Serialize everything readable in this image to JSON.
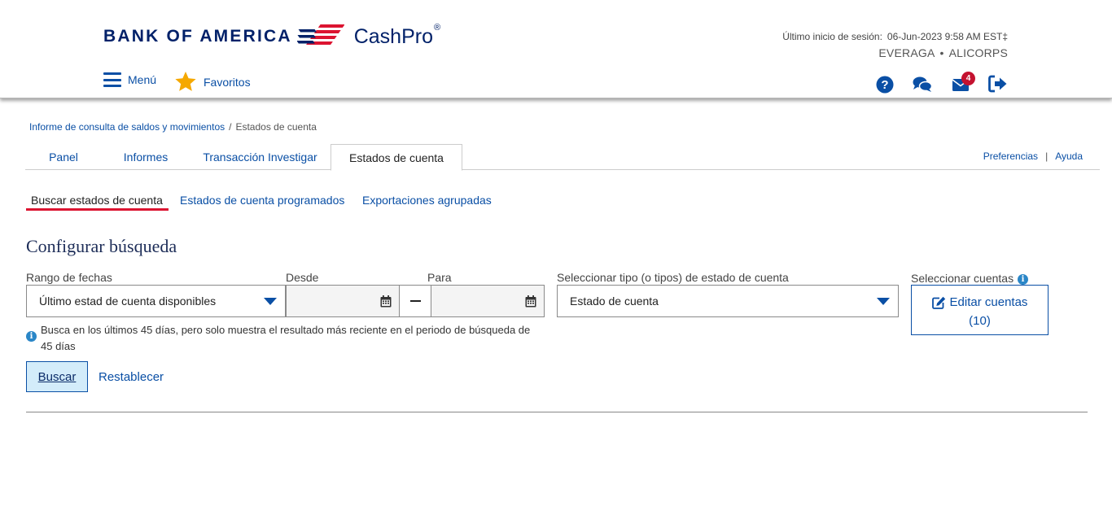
{
  "brand": {
    "bank_name": "BANK OF AMERICA",
    "product": "CashPro",
    "product_mark": "®"
  },
  "session": {
    "last_login_label": "Último inicio de sesión:",
    "last_login_value": "06-Jun-2023 9:58 AM EST‡",
    "user": "EVERAGA",
    "separator": "•",
    "company": "ALICORPS"
  },
  "nav": {
    "menu_label": "Menú",
    "favorites_label": "Favoritos",
    "messages_count": "4"
  },
  "breadcrumb": {
    "parent": "Informe de consulta de saldos y movimientos",
    "separator": "/",
    "current": "Estados de cuenta"
  },
  "tabs": [
    {
      "label": "Panel"
    },
    {
      "label": "Informes"
    },
    {
      "label": "Transacción Investigar"
    },
    {
      "label": "Estados de cuenta",
      "active": true
    }
  ],
  "toplinks": {
    "preferences": "Preferencias",
    "separator": "|",
    "help": "Ayuda"
  },
  "subtabs": [
    {
      "label": "Buscar estados de cuenta",
      "active": true
    },
    {
      "label": "Estados de cuenta programados"
    },
    {
      "label": "Exportaciones agrupadas"
    }
  ],
  "form": {
    "title": "Configurar búsqueda",
    "date_range_label": "Rango de fechas",
    "date_range_value": "Último estad de cuenta disponibles",
    "from_label": "Desde",
    "from_value": "",
    "to_label": "Para",
    "to_value": "",
    "statement_type_label": "Seleccionar tipo (o tipos) de estado de cuenta",
    "statement_type_value": "Estado de cuenta",
    "accounts_label": "Seleccionar cuentas",
    "edit_accounts_label": "Editar cuentas",
    "edit_accounts_count": "(10)",
    "info_note": "Busca en los últimos 45 días, pero solo muestra el resultado más reciente en el periodo de búsqueda de 45 días",
    "search_button": "Buscar",
    "reset_link": "Restablecer"
  },
  "colors": {
    "brand_navy": "#012169",
    "brand_red": "#dc1431",
    "link_blue": "#0a4fa5",
    "badge_red": "#c41230",
    "button_fill": "#d3ecfa",
    "favorite_star": "#f5a800"
  }
}
